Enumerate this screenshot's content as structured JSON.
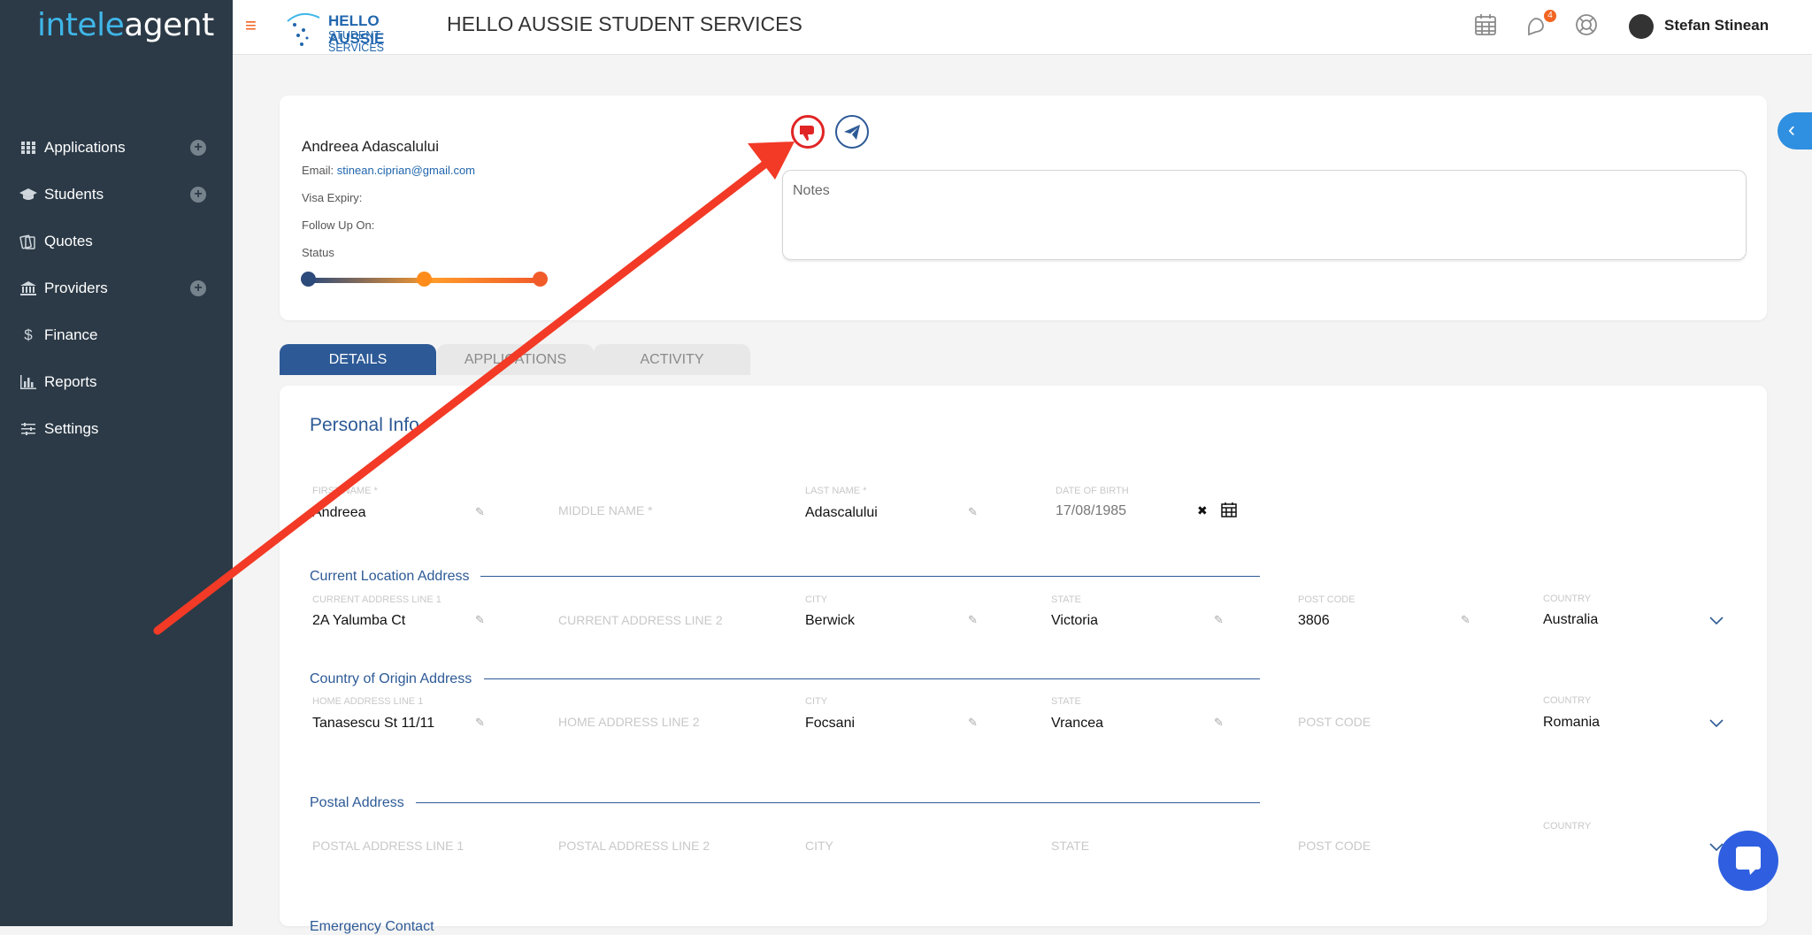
{
  "app": {
    "logo_part1": "intele",
    "logo_part2": "agent"
  },
  "sidebar": {
    "items": [
      {
        "label": "Applications",
        "icon": "grid-icon",
        "has_add": true
      },
      {
        "label": "Students",
        "icon": "graduation-cap-icon",
        "has_add": true
      },
      {
        "label": "Quotes",
        "icon": "quotes-icon",
        "has_add": false
      },
      {
        "label": "Providers",
        "icon": "bank-icon",
        "has_add": true
      },
      {
        "label": "Finance",
        "icon": "dollar-icon",
        "has_add": false
      },
      {
        "label": "Reports",
        "icon": "bar-chart-icon",
        "has_add": false
      },
      {
        "label": "Settings",
        "icon": "sliders-icon",
        "has_add": false
      }
    ],
    "add_symbol": "+"
  },
  "header": {
    "brand_line1": "HELLO AUSSIE",
    "brand_line2": "STUDENT SERVICES",
    "company": "HELLO AUSSIE STUDENT SERVICES",
    "notification_count": "4",
    "user": "Stefan Stinean"
  },
  "student": {
    "name": "Andreea Adascalului",
    "email_label": "Email:",
    "email": "stinean.ciprian@gmail.com",
    "visa_label": "Visa Expiry:",
    "followup_label": "Follow Up On:",
    "status_label": "Status",
    "status_colors": [
      "#2c4a7a",
      "#ff8c1a",
      "#f15b2a"
    ],
    "notes_placeholder": "Notes"
  },
  "tabs": [
    "DETAILS",
    "APPLICATIONS",
    "ACTIVITY"
  ],
  "personal": {
    "title": "Personal Info",
    "first_name_label": "FIRST NAME *",
    "first_name": "Andreea",
    "middle_name_placeholder": "MIDDLE NAME *",
    "last_name_label": "LAST NAME *",
    "last_name": "Adascalului",
    "dob_label": "DATE OF BIRTH",
    "dob": "17/08/1985",
    "clear_symbol": "✖"
  },
  "current_address": {
    "title": "Current Location Address",
    "line1_label": "CURRENT ADDRESS LINE 1",
    "line1": "2A Yalumba Ct",
    "line2_placeholder": "CURRENT ADDRESS LINE 2",
    "city_label": "CITY",
    "city": "Berwick",
    "state_label": "STATE",
    "state": "Victoria",
    "post_label": "POST CODE",
    "post": "3806",
    "country_label": "COUNTRY",
    "country": "Australia"
  },
  "origin_address": {
    "title": "Country of Origin Address",
    "line1_label": "HOME ADDRESS LINE 1",
    "line1": "Tanasescu St 11/11",
    "line2_placeholder": "HOME ADDRESS LINE 2",
    "city_label": "CITY",
    "city": "Focsani",
    "state_label": "STATE",
    "state": "Vrancea",
    "post_placeholder": "POST CODE",
    "country_label": "COUNTRY",
    "country": "Romania"
  },
  "postal_address": {
    "title": "Postal Address",
    "line1_placeholder": "POSTAL ADDRESS LINE 1",
    "line2_placeholder": "POSTAL ADDRESS LINE 2",
    "city_placeholder": "CITY",
    "state_placeholder": "STATE",
    "post_placeholder": "POST CODE",
    "country_label": "COUNTRY"
  },
  "emergency": {
    "title": "Emergency Contact"
  }
}
